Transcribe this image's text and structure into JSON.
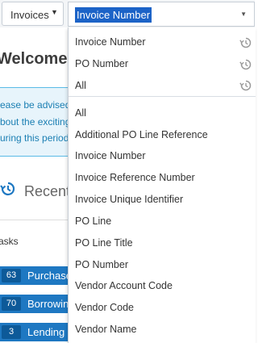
{
  "topbar": {
    "scope_label": "Invoices",
    "field_value": "Invoice Number"
  },
  "background": {
    "welcome": "Welcome,",
    "notice_lines": [
      "ease be advised",
      "bout the exciting",
      "uring this period"
    ],
    "recent_label": "Recent",
    "tasks_label": "asks",
    "tasks": [
      {
        "count": "63",
        "label": "Purchase"
      },
      {
        "count": "70",
        "label": "Borrowing"
      },
      {
        "count": "3",
        "label": "Lending"
      }
    ]
  },
  "menu": {
    "recent_items": [
      "Invoice Number",
      "PO Number",
      "All"
    ],
    "options": [
      "All",
      "Additional PO Line Reference",
      "Invoice Number",
      "Invoice Reference Number",
      "Invoice Unique Identifier",
      "PO Line",
      "PO Line Title",
      "PO Number",
      "Vendor Account Code",
      "Vendor Code",
      "Vendor Name"
    ]
  },
  "colors": {
    "accent": "#1c63c7",
    "task_row": "#1e78c2",
    "notice_bg": "#e7f4fb",
    "notice_text": "#1b7fb3"
  }
}
